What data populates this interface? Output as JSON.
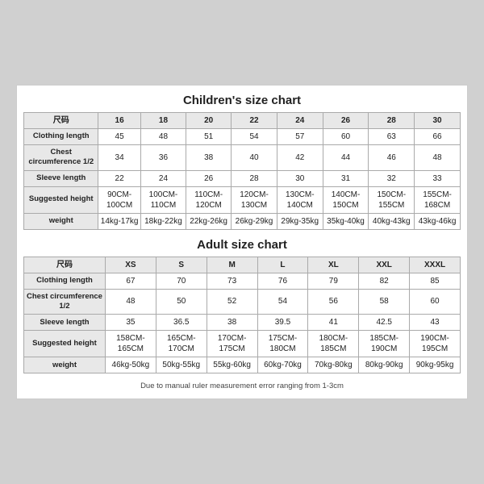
{
  "children_chart": {
    "title": "Children's size chart",
    "columns": [
      "尺码",
      "16",
      "18",
      "20",
      "22",
      "24",
      "26",
      "28",
      "30"
    ],
    "rows": [
      {
        "label": "Clothing length",
        "values": [
          "45",
          "48",
          "51",
          "54",
          "57",
          "60",
          "63",
          "66"
        ]
      },
      {
        "label": "Chest circumference 1/2",
        "values": [
          "34",
          "36",
          "38",
          "40",
          "42",
          "44",
          "46",
          "48"
        ]
      },
      {
        "label": "Sleeve length",
        "values": [
          "22",
          "24",
          "26",
          "28",
          "30",
          "31",
          "32",
          "33"
        ]
      },
      {
        "label": "Suggested height",
        "values": [
          "90CM-100CM",
          "100CM-110CM",
          "110CM-120CM",
          "120CM-130CM",
          "130CM-140CM",
          "140CM-150CM",
          "150CM-155CM",
          "155CM-168CM"
        ]
      },
      {
        "label": "weight",
        "values": [
          "14kg-17kg",
          "18kg-22kg",
          "22kg-26kg",
          "26kg-29kg",
          "29kg-35kg",
          "35kg-40kg",
          "40kg-43kg",
          "43kg-46kg"
        ]
      }
    ]
  },
  "adult_chart": {
    "title": "Adult size chart",
    "columns": [
      "尺码",
      "XS",
      "S",
      "M",
      "L",
      "XL",
      "XXL",
      "XXXL"
    ],
    "rows": [
      {
        "label": "Clothing length",
        "values": [
          "67",
          "70",
          "73",
          "76",
          "79",
          "82",
          "85"
        ]
      },
      {
        "label": "Chest circumference 1/2",
        "values": [
          "48",
          "50",
          "52",
          "54",
          "56",
          "58",
          "60"
        ]
      },
      {
        "label": "Sleeve length",
        "values": [
          "35",
          "36.5",
          "38",
          "39.5",
          "41",
          "42.5",
          "43"
        ]
      },
      {
        "label": "Suggested height",
        "values": [
          "158CM-165CM",
          "165CM-170CM",
          "170CM-175CM",
          "175CM-180CM",
          "180CM-185CM",
          "185CM-190CM",
          "190CM-195CM"
        ]
      },
      {
        "label": "weight",
        "values": [
          "46kg-50kg",
          "50kg-55kg",
          "55kg-60kg",
          "60kg-70kg",
          "70kg-80kg",
          "80kg-90kg",
          "90kg-95kg"
        ]
      }
    ]
  },
  "footer": {
    "note": "Due to manual ruler measurement error ranging from 1-3cm"
  }
}
